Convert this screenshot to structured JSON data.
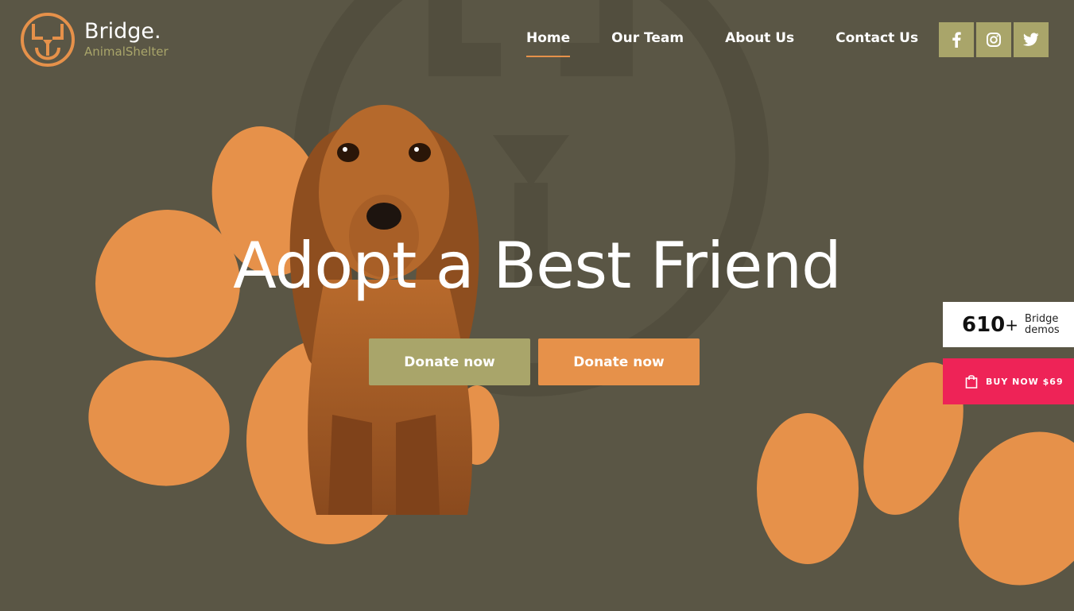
{
  "colors": {
    "background": "#5a5645",
    "accent_orange": "#e6914a",
    "accent_olive": "#a9a56a",
    "buy_pink": "#ee2357"
  },
  "header": {
    "brand": "Bridge.",
    "brand_sub": "AnimalShelter",
    "logo_icon": "dog-face-logo"
  },
  "nav": {
    "items": [
      {
        "label": "Home",
        "active": true
      },
      {
        "label": "Our Team",
        "active": false
      },
      {
        "label": "About Us",
        "active": false
      },
      {
        "label": "Contact Us",
        "active": false
      }
    ]
  },
  "social": {
    "icons": [
      "facebook-icon",
      "instagram-icon",
      "twitter-icon"
    ]
  },
  "hero": {
    "title": "Adopt a Best Friend",
    "buttons": [
      "Donate now",
      "Donate now"
    ]
  },
  "widgets": {
    "demos_count": "610",
    "demos_plus": "+",
    "demos_label": "Bridge demos",
    "buy_label": "BUY NOW $69",
    "buy_icon": "shopping-bag-icon"
  }
}
